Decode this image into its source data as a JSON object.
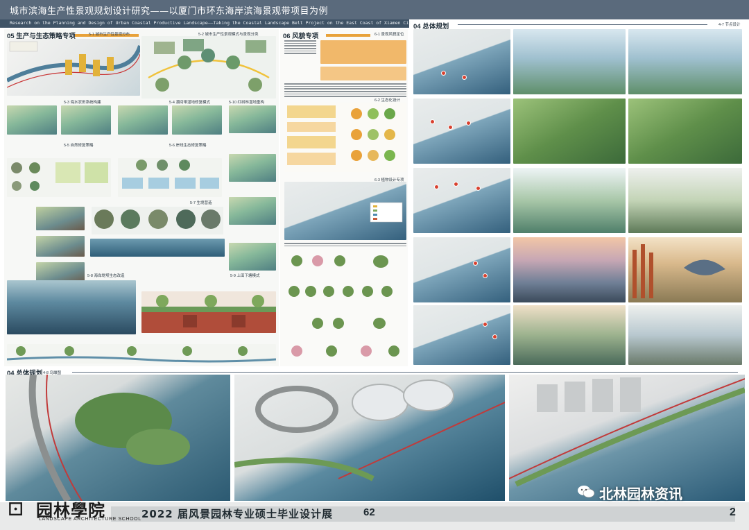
{
  "header": {
    "title": "城市滨海生产性景观规划设计研究——以厦门市环东海岸滨海景观带项目为例",
    "subtitle": "Research on the Planning and Design of Urban Coastal Productive Landscape——Taking the Coastal Landscape Belt Project on the East Coast of Xiamen City as an Example"
  },
  "panel_left": {
    "section_title": "05 生产与生态策略专项",
    "sub_titles": {
      "s51": "5-1 城市生产性景观分布",
      "s52": "5-2 城市生产性景观模式与景观分类",
      "s53": "5-3 海水农田系统构建",
      "s54": "5-4 潮间带湿地修复模式",
      "s510": "5-10 红树林湿地重构",
      "s55": "5-5 自然修复策略",
      "s56": "5-6 岸线生态修复策略",
      "s57": "5-7 生境营造",
      "s58": "5-8 海岸堤坝生态改造",
      "s59": "5-9 上田下塘模式"
    }
  },
  "panel_mid": {
    "section_title": "06 风貌专项",
    "sub_titles": {
      "s61": "6-1 景观风貌定位",
      "s62": "6-2 生态化设计",
      "s63": "6-3 植物设计专项"
    }
  },
  "panel_right": {
    "section_title": "04 总体规划",
    "tag": "4-7 节点设计"
  },
  "panel_bottom": {
    "section_title": "04 总体规划",
    "tag": "4-8 鸟瞰图"
  },
  "footer": {
    "logo_glyph": "⊡",
    "logo_name": "园林學院",
    "logo_en": "LANDSCAPE ARCHITECTURE SCHOOL",
    "exhibition": "2022 届风景园林专业硕士毕业设计展",
    "exhibition_number": "62",
    "page_number": "2",
    "watermark": "北林园林资讯"
  },
  "colors": {
    "header_band": "#5a6a7c",
    "accent_orange": "#e8a23a",
    "water_blue": "#2f5e78",
    "pin_red": "#d8412f"
  }
}
